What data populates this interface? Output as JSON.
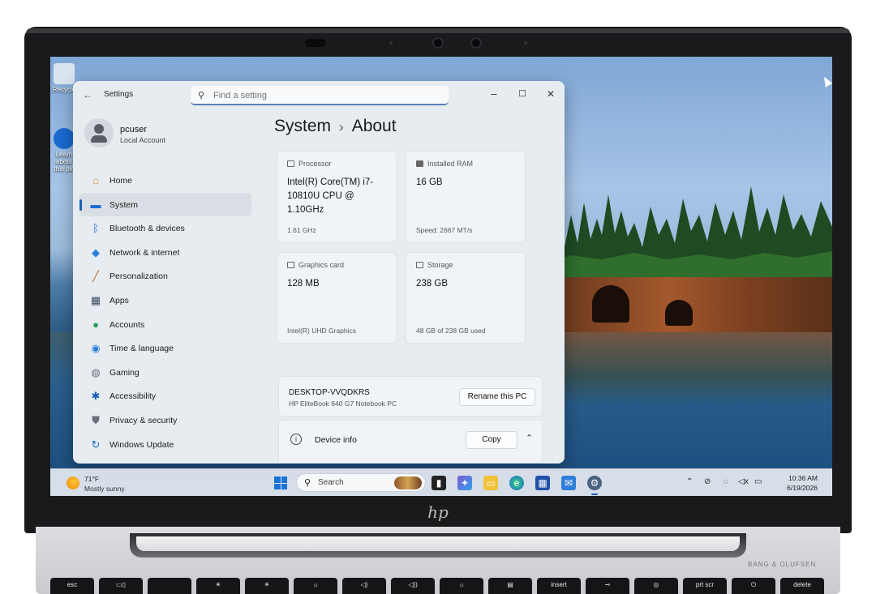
{
  "desktop": {
    "icons": [
      {
        "label": "Recycle"
      },
      {
        "label": "Learn about this pic"
      }
    ]
  },
  "window": {
    "title": "Settings",
    "search_placeholder": "Find a setting",
    "controls": {
      "minimize": "–",
      "maximize": "☐",
      "close": "✕"
    }
  },
  "user": {
    "name": "pcuser",
    "account_type": "Local Account"
  },
  "nav": {
    "items": [
      {
        "label": "Home",
        "icon": "home-icon",
        "glyph": "⌂",
        "color": "#d98b3a"
      },
      {
        "label": "System",
        "icon": "monitor-icon",
        "glyph": "▬",
        "color": "#1a6ad0",
        "active": true
      },
      {
        "label": "Bluetooth & devices",
        "icon": "bluetooth-icon",
        "glyph": "ᛒ",
        "color": "#1a6ad0"
      },
      {
        "label": "Network & internet",
        "icon": "wifi-icon",
        "glyph": "◆",
        "color": "#2a7fd8"
      },
      {
        "label": "Personalization",
        "icon": "brush-icon",
        "glyph": "╱",
        "color": "#b36a2a"
      },
      {
        "label": "Apps",
        "icon": "apps-icon",
        "glyph": "▦",
        "color": "#3c4a5e"
      },
      {
        "label": "Accounts",
        "icon": "person-icon",
        "glyph": "●",
        "color": "#2e9a5a"
      },
      {
        "label": "Time & language",
        "icon": "globe-icon",
        "glyph": "◉",
        "color": "#2a7fd8"
      },
      {
        "label": "Gaming",
        "icon": "gamepad-icon",
        "glyph": "◍",
        "color": "#6a6f77"
      },
      {
        "label": "Accessibility",
        "icon": "accessibility-icon",
        "glyph": "✱",
        "color": "#1a5fb4"
      },
      {
        "label": "Privacy & security",
        "icon": "shield-icon",
        "glyph": "⛊",
        "color": "#6a6f77"
      },
      {
        "label": "Windows Update",
        "icon": "update-icon",
        "glyph": "↻",
        "color": "#1a6ad0"
      }
    ]
  },
  "breadcrumb": {
    "parent": "System",
    "separator": "›",
    "current": "About"
  },
  "specs": {
    "processor": {
      "label": "Processor",
      "value": "Intel(R) Core(TM) i7-10810U CPU @ 1.10GHz",
      "sub": "1.61 GHz"
    },
    "ram": {
      "label": "Installed RAM",
      "value": "16 GB",
      "sub": "Speed: 2667 MT/s"
    },
    "graphics": {
      "label": "Graphics card",
      "value": "128 MB",
      "sub": "Intel(R) UHD Graphics"
    },
    "storage": {
      "label": "Storage",
      "value": "238 GB",
      "sub": "48 GB of 238 GB used"
    }
  },
  "device": {
    "name": "DESKTOP-VVQDKRS",
    "model": "HP EliteBook 840 G7 Notebook PC",
    "rename_label": "Rename this PC",
    "info_label": "Device info",
    "copy_label": "Copy",
    "info_glyph": "i",
    "chevron": "⌃"
  },
  "taskbar": {
    "weather_temp": "71°F",
    "weather_condition": "Mostly sunny",
    "search_label": "Search",
    "search_glyph": "⚲",
    "tray_chevron": "⌃",
    "time": "10:36 AM",
    "date": "6/19/2026"
  },
  "laptop": {
    "logo": "hp",
    "brand": "BANG & OLUFSEN",
    "keys": [
      "esc",
      "▭▯",
      "",
      "☀",
      "☀",
      "☼",
      "◁)",
      "◁))",
      "☼",
      "▤",
      "insert",
      "⊸",
      "◎",
      "prt scr",
      "⏻",
      "delete"
    ]
  },
  "colors": {
    "accent": "#1a5fb4"
  }
}
